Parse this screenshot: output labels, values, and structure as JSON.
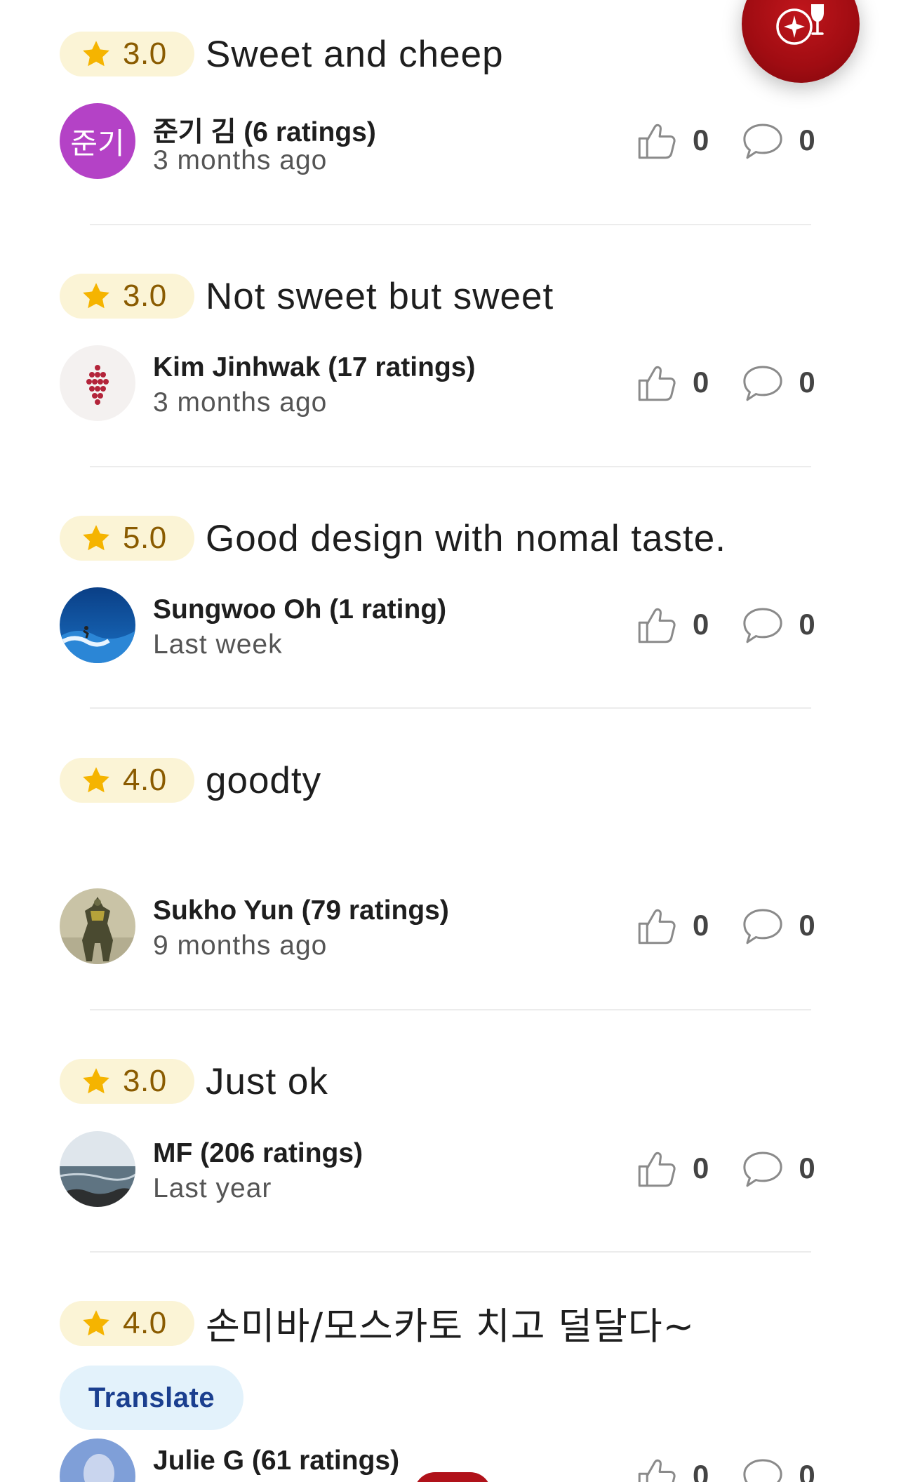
{
  "reviews": [
    {
      "rating": "3.0",
      "text": "Sweet  and cheep",
      "user": "준기 김 (6 ratings)",
      "time": "3 months ago",
      "avatar": {
        "type": "initials",
        "initials": "준기",
        "color": "#b442c6"
      },
      "likes": "0",
      "comments": "0"
    },
    {
      "rating": "3.0",
      "text": "Not sweet but sweet",
      "user": "Kim Jinhwak (17 ratings)",
      "time": "3 months ago",
      "avatar": {
        "type": "grapes-icon",
        "color": "#b3243a"
      },
      "likes": "0",
      "comments": "0"
    },
    {
      "rating": "5.0",
      "text": "Good design with nomal taste.",
      "user": "Sungwoo Oh (1 rating)",
      "time": "Last week",
      "avatar": {
        "type": "photo-surfer"
      },
      "likes": "0",
      "comments": "0"
    },
    {
      "rating": "4.0",
      "text": "goodty",
      "user": "Sukho Yun (79 ratings)",
      "time": "9 months ago",
      "avatar": {
        "type": "photo-robot-figure"
      },
      "likes": "0",
      "comments": "0"
    },
    {
      "rating": "3.0",
      "text": "Just ok",
      "user": "MF (206 ratings)",
      "time": "Last year",
      "avatar": {
        "type": "photo-sea"
      },
      "likes": "0",
      "comments": "0"
    },
    {
      "rating": "4.0",
      "text": "손미바/모스카토 치고 덜달다~",
      "translate_label": "Translate",
      "user": "Julie G (61 ratings)",
      "time": "",
      "avatar": {
        "type": "photo-person-blue"
      },
      "likes": "0",
      "comments": "0"
    }
  ],
  "fab": {
    "icon": "wine-compass-icon",
    "color": "#a80d14"
  },
  "colors": {
    "rating_pill_bg": "#fbf4d6",
    "rating_text": "#8a5b00",
    "star": "#f5b400",
    "translate_bg": "#e3f2fb",
    "translate_text": "#1b3f8f"
  }
}
